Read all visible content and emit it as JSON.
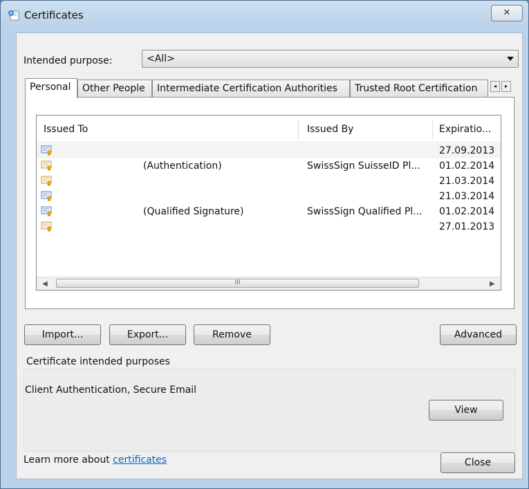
{
  "window": {
    "title": "Certificates",
    "close_glyph": "✕"
  },
  "purpose": {
    "label": "Intended purpose:",
    "value": "<All>"
  },
  "tabs": [
    {
      "label": "Personal"
    },
    {
      "label": "Other People"
    },
    {
      "label": "Intermediate Certification Authorities"
    },
    {
      "label": "Trusted Root Certification"
    }
  ],
  "table": {
    "columns": [
      "Issued To",
      "Issued By",
      "Expiratio..."
    ],
    "rows": [
      {
        "issued_to": "",
        "issued_by": "",
        "expiration": "27.09.2013"
      },
      {
        "issued_to": "(Authentication)",
        "issued_by": "SwissSign SuisseID Pl...",
        "expiration": "01.02.2014"
      },
      {
        "issued_to": "",
        "issued_by": "",
        "expiration": "21.03.2014"
      },
      {
        "issued_to": "",
        "issued_by": "",
        "expiration": "21.03.2014"
      },
      {
        "issued_to": "(Qualified Signature)",
        "issued_by": "SwissSign Qualified Pl...",
        "expiration": "01.02.2014"
      },
      {
        "issued_to": "",
        "issued_by": "",
        "expiration": "27.01.2013"
      }
    ],
    "scroll_thumb_grip": "III"
  },
  "buttons": {
    "import": "Import...",
    "export": "Export...",
    "remove": "Remove",
    "advanced": "Advanced",
    "view": "View",
    "close": "Close"
  },
  "purposes_group": {
    "title": "Certificate intended purposes",
    "text": "Client Authentication, Secure Email"
  },
  "footer": {
    "learn_prefix": "Learn more about ",
    "learn_link": "certificates"
  }
}
